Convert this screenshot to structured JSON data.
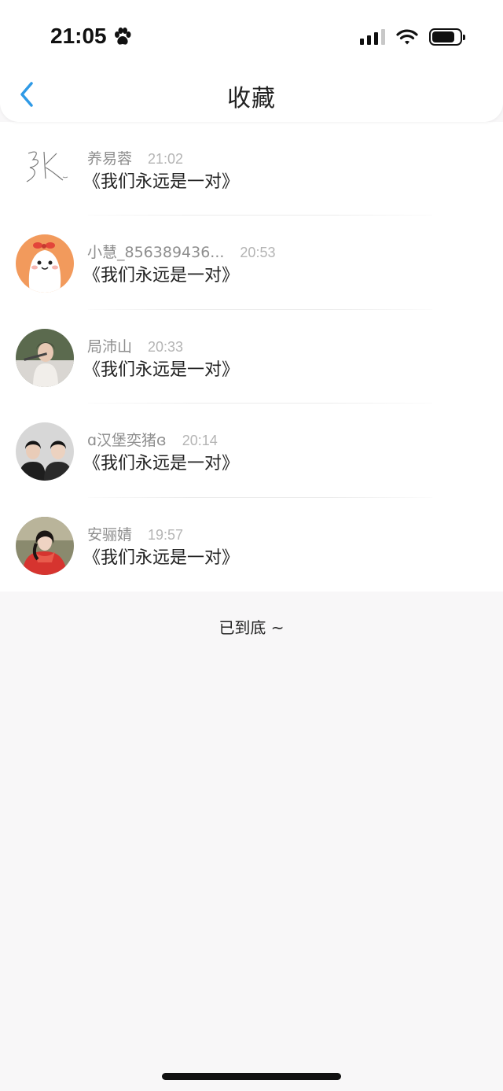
{
  "status_bar": {
    "time": "21:05"
  },
  "nav": {
    "title": "收藏"
  },
  "items": [
    {
      "name": "养易蓉",
      "time": "21:02",
      "text": "《我们永远是一对》",
      "avatar": "handwritten-signature-avatar"
    },
    {
      "name": "小慧_856389436...",
      "time": "20:53",
      "text": "《我们永远是一对》",
      "avatar": "cartoon-bunny-avatar"
    },
    {
      "name": "局沛山",
      "time": "20:33",
      "text": "《我们永远是一对》",
      "avatar": "portrait-photo-avatar"
    },
    {
      "name": "ɑ汉堡奕猪ɞ",
      "time": "20:14",
      "text": "《我们永远是一对》",
      "avatar": "couple-photo-avatar"
    },
    {
      "name": "安骊婧",
      "time": "19:57",
      "text": "《我们永远是一对》",
      "avatar": "red-scarf-photo-avatar"
    }
  ],
  "footer": {
    "end_text": "已到底 ~"
  },
  "colors": {
    "accent": "#2f9ae6",
    "name": "#8e8e8e",
    "time": "#b4b4b4",
    "background": "#f8f7f8"
  }
}
